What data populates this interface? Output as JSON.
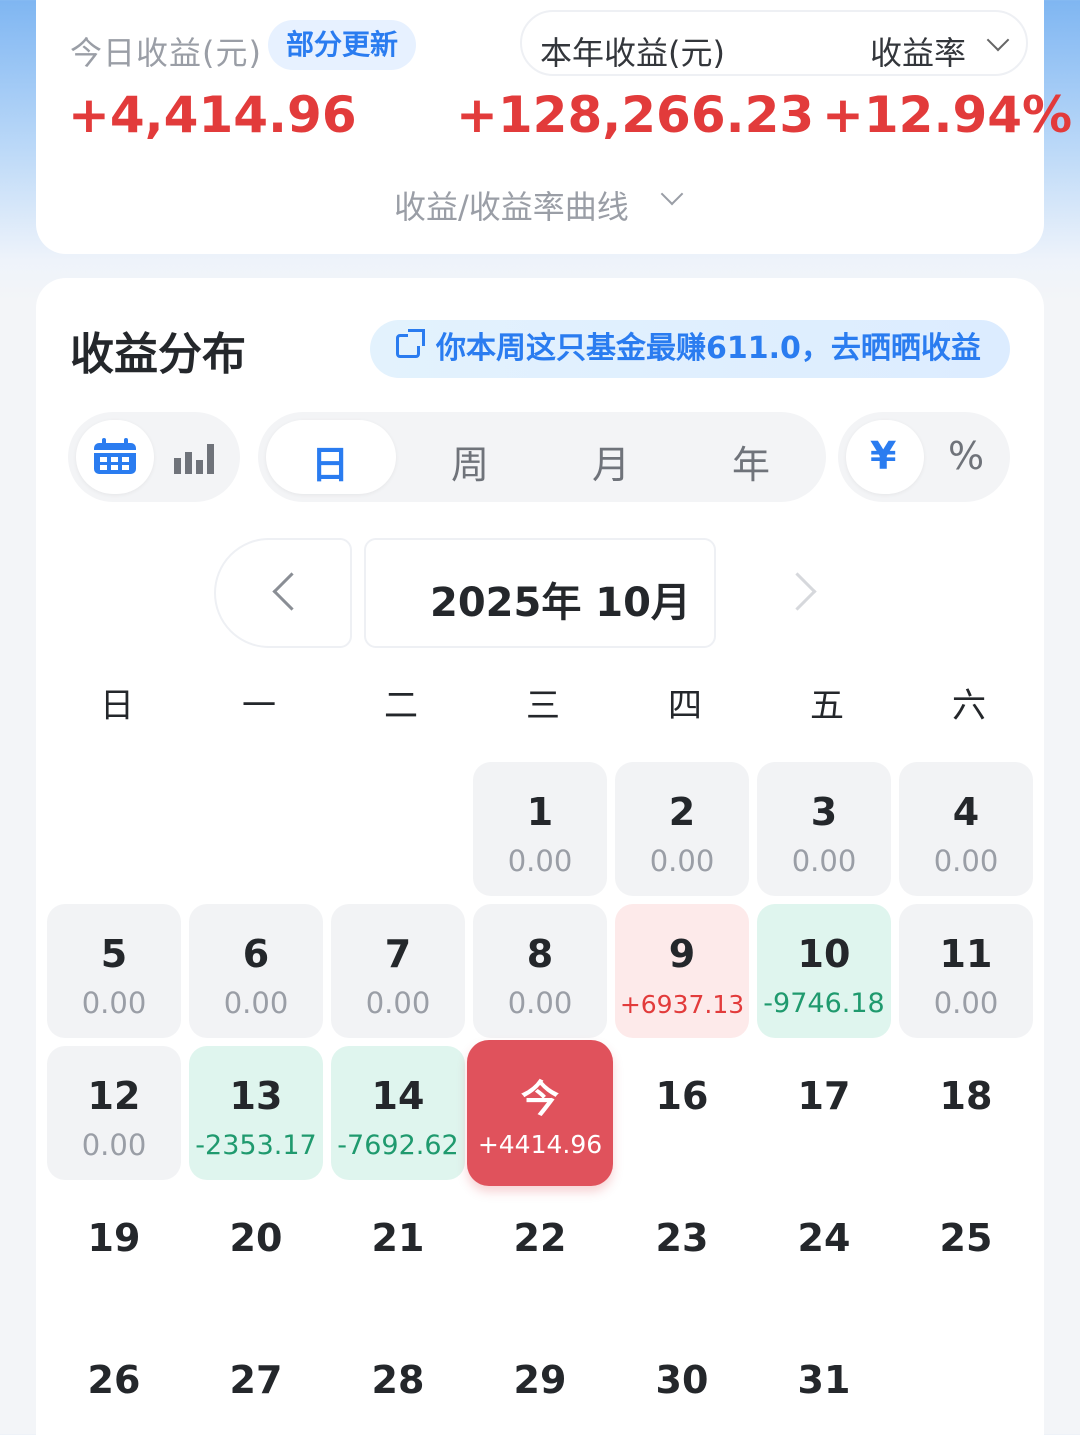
{
  "summary": {
    "today_label": "今日收益(元)",
    "partial_badge": "部分更新",
    "year_label": "本年收益(元)",
    "rate_label": "收益率",
    "today_value": "+4,414.96",
    "year_value": "+128,266.23",
    "rate_value": "+12.94%",
    "curve_label": "收益/收益率曲线"
  },
  "distribution": {
    "title": "收益分布",
    "promo": "你本周这只基金最赚611.0，去晒晒收益",
    "period_tabs": [
      "日",
      "周",
      "月",
      "年"
    ],
    "active_period": "日",
    "unit_tabs": [
      "¥",
      "%"
    ],
    "active_unit": "¥",
    "view_icons": [
      "calendar-icon",
      "bar-chart-icon"
    ],
    "month_title": "2025年 10月",
    "weekdays": [
      "日",
      "一",
      "二",
      "三",
      "四",
      "五",
      "六"
    ],
    "days": [
      {
        "day": "1",
        "value": "0.00",
        "state": "zero"
      },
      {
        "day": "2",
        "value": "0.00",
        "state": "zero"
      },
      {
        "day": "3",
        "value": "0.00",
        "state": "zero"
      },
      {
        "day": "4",
        "value": "0.00",
        "state": "zero"
      },
      {
        "day": "5",
        "value": "0.00",
        "state": "zero"
      },
      {
        "day": "6",
        "value": "0.00",
        "state": "zero"
      },
      {
        "day": "7",
        "value": "0.00",
        "state": "zero"
      },
      {
        "day": "8",
        "value": "0.00",
        "state": "zero"
      },
      {
        "day": "9",
        "value": "+6937.13",
        "state": "up"
      },
      {
        "day": "10",
        "value": "-9746.18",
        "state": "down"
      },
      {
        "day": "11",
        "value": "0.00",
        "state": "zero"
      },
      {
        "day": "12",
        "value": "0.00",
        "state": "zero"
      },
      {
        "day": "13",
        "value": "-2353.17",
        "state": "down"
      },
      {
        "day": "14",
        "value": "-7692.62",
        "state": "down"
      },
      {
        "day": "今",
        "value": "+4414.96",
        "state": "today"
      },
      {
        "day": "16",
        "value": "",
        "state": "plain"
      },
      {
        "day": "17",
        "value": "",
        "state": "plain"
      },
      {
        "day": "18",
        "value": "",
        "state": "plain"
      },
      {
        "day": "19",
        "value": "",
        "state": "plain"
      },
      {
        "day": "20",
        "value": "",
        "state": "plain"
      },
      {
        "day": "21",
        "value": "",
        "state": "plain"
      },
      {
        "day": "22",
        "value": "",
        "state": "plain"
      },
      {
        "day": "23",
        "value": "",
        "state": "plain"
      },
      {
        "day": "24",
        "value": "",
        "state": "plain"
      },
      {
        "day": "25",
        "value": "",
        "state": "plain"
      },
      {
        "day": "26",
        "value": "",
        "state": "plain"
      },
      {
        "day": "27",
        "value": "",
        "state": "plain"
      },
      {
        "day": "28",
        "value": "",
        "state": "plain"
      },
      {
        "day": "29",
        "value": "",
        "state": "plain"
      },
      {
        "day": "30",
        "value": "",
        "state": "plain"
      },
      {
        "day": "31",
        "value": "",
        "state": "plain"
      }
    ]
  },
  "colors": {
    "accent": "#2a7cf0",
    "gain": "#e23b3b",
    "loss": "#1f9a6e",
    "today": "#e0525c"
  }
}
